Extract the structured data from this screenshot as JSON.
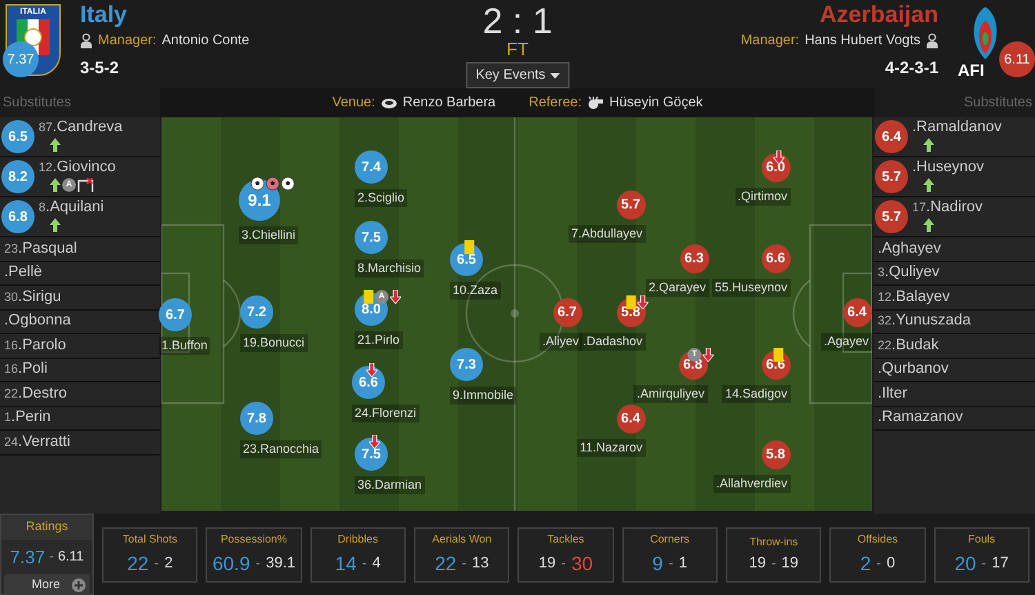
{
  "home": {
    "name": "Italy",
    "logo_text": "ITALIA",
    "rating": "7.37",
    "manager_label": "Manager:",
    "manager": "Antonio Conte",
    "formation": "3-5-2"
  },
  "away": {
    "name": "Azerbaijan",
    "logo_text": "AFI",
    "rating": "6.11",
    "manager_label": "Manager:",
    "manager": "Hans Hubert Vogts",
    "formation": "4-2-3-1"
  },
  "score": "2 : 1",
  "status": "FT",
  "key_events_button": "Key Events",
  "venue_bar": {
    "left_title": "Substitutes",
    "venue_label": "Venue:",
    "venue": "Renzo Barbera",
    "referee_label": "Referee:",
    "referee": "Hüseyin Göçek",
    "right_title": "Substitutes"
  },
  "home_subs": [
    {
      "number": "87",
      "name": ".Candreva",
      "rating": "6.5",
      "events": [
        {
          "kind": "sub_on"
        }
      ]
    },
    {
      "number": "12",
      "name": ".Giovinco",
      "rating": "8.2",
      "events": [
        {
          "kind": "sub_on"
        },
        {
          "kind": "letter",
          "label": "A"
        },
        {
          "kind": "goal_miss"
        }
      ]
    },
    {
      "number": "8",
      "name": ".Aquilani",
      "rating": "6.8",
      "events": [
        {
          "kind": "sub_on"
        }
      ]
    },
    {
      "number": "23",
      "name": ".Pasqual"
    },
    {
      "name": ".Pellè"
    },
    {
      "number": "30",
      "name": ".Sirigu"
    },
    {
      "name": ".Ogbonna"
    },
    {
      "number": "16",
      "name": ".Parolo"
    },
    {
      "number": "16",
      "name": ".Poli"
    },
    {
      "number": "22",
      "name": ".Destro"
    },
    {
      "number": "1",
      "name": ".Perin"
    },
    {
      "number": "24",
      "name": ".Verratti"
    }
  ],
  "away_subs": [
    {
      "name": ".Ramaldanov",
      "rating": "6.4",
      "events": [
        {
          "kind": "sub_on"
        }
      ]
    },
    {
      "name": ".Huseynov",
      "rating": "5.7",
      "events": [
        {
          "kind": "sub_on"
        }
      ]
    },
    {
      "number": "17",
      "name": ".Nadirov",
      "rating": "5.7",
      "events": [
        {
          "kind": "sub_on"
        }
      ]
    },
    {
      "name": ".Aghayev"
    },
    {
      "number": "3",
      "name": ".Quliyev"
    },
    {
      "number": "12",
      "name": ".Balayev"
    },
    {
      "number": "32",
      "name": ".Yunuszada"
    },
    {
      "number": "22",
      "name": ".Budak"
    },
    {
      "name": ".Qurbanov"
    },
    {
      "name": ".Ilter"
    },
    {
      "name": ".Ramazanov"
    }
  ],
  "home_players": [
    {
      "label": "1.Buffon",
      "rating": "6.7",
      "motm": false
    },
    {
      "label": "3.Chiellini",
      "rating": "9.1",
      "motm": true,
      "events": [
        {
          "kind": "goal"
        },
        {
          "kind": "own_goal"
        },
        {
          "kind": "goal"
        }
      ]
    },
    {
      "label": "19.Bonucci",
      "rating": "7.2",
      "motm": false
    },
    {
      "label": "23.Ranocchia",
      "rating": "7.8",
      "motm": false
    },
    {
      "label": "2.Sciglio",
      "rating": "7.4",
      "motm": false
    },
    {
      "label": "8.Marchisio",
      "rating": "7.5",
      "motm": false
    },
    {
      "label": "21.Pirlo",
      "rating": "8.0",
      "motm": false,
      "events": [
        {
          "kind": "yellow_card"
        },
        {
          "kind": "letter",
          "label": "A"
        },
        {
          "kind": "sub_off"
        }
      ]
    },
    {
      "label": "24.Florenzi",
      "rating": "6.6",
      "motm": false,
      "events": [
        {
          "kind": "sub_off"
        }
      ]
    },
    {
      "label": "36.Darmian",
      "rating": "7.5",
      "motm": false,
      "events": [
        {
          "kind": "sub_off"
        }
      ]
    },
    {
      "label": "10.Zaza",
      "rating": "6.5",
      "motm": false,
      "events": [
        {
          "kind": "yellow_card"
        }
      ]
    },
    {
      "label": "9.Immobile",
      "rating": "7.3",
      "motm": false
    }
  ],
  "away_players": [
    {
      "label": ".Aliyev",
      "rating": "6.7",
      "motm": false
    },
    {
      "label": "7.Abdullayev",
      "rating": "5.7",
      "motm": false
    },
    {
      "label": ".Dadashov",
      "rating": "5.8",
      "motm": false,
      "events": [
        {
          "kind": "yellow_card"
        },
        {
          "kind": "sub_off"
        }
      ]
    },
    {
      "label": "11.Nazarov",
      "rating": "6.4",
      "motm": false
    },
    {
      "label": "2.Qarayev",
      "rating": "6.3",
      "motm": false
    },
    {
      "label": ".Amirquliyev",
      "rating": "6.8",
      "motm": false,
      "events": [
        {
          "kind": "letter",
          "label": "T"
        },
        {
          "kind": "sub_off"
        }
      ]
    },
    {
      "label": ".Qirtimov",
      "rating": "6.0",
      "motm": false,
      "events": [
        {
          "kind": "sub_off"
        }
      ]
    },
    {
      "label": "55.Huseynov",
      "rating": "6.6",
      "motm": false
    },
    {
      "label": "14.Sadigov",
      "rating": "6.6",
      "motm": false,
      "events": [
        {
          "kind": "yellow_card"
        }
      ]
    },
    {
      "label": ".Allahverdiev",
      "rating": "5.8",
      "motm": false
    },
    {
      "label": ".Agayev",
      "rating": "6.4",
      "motm": false
    }
  ],
  "ratings": {
    "title": "Ratings",
    "home": "7.37",
    "separator": "-",
    "away": "6.11",
    "more_button": "More"
  },
  "stats": [
    {
      "title": "Total Shots",
      "home": "22",
      "separator": "-",
      "away": "2",
      "home_leads": true,
      "away_leads": false
    },
    {
      "title": "Possession%",
      "home": "60.9",
      "separator": "-",
      "away": "39.1",
      "home_leads": true,
      "away_leads": false
    },
    {
      "title": "Dribbles",
      "home": "14",
      "separator": "-",
      "away": "4",
      "home_leads": true,
      "away_leads": false
    },
    {
      "title": "Aerials Won",
      "home": "22",
      "separator": "-",
      "away": "13",
      "home_leads": true,
      "away_leads": false
    },
    {
      "title": "Tackles",
      "home": "19",
      "separator": "-",
      "away": "30",
      "home_leads": false,
      "away_leads": true
    },
    {
      "title": "Corners",
      "home": "9",
      "separator": "-",
      "away": "1",
      "home_leads": true,
      "away_leads": false
    },
    {
      "title": "Throw-ins",
      "home": "19",
      "separator": "-",
      "away": "19",
      "home_leads": false,
      "away_leads": false
    },
    {
      "title": "Offsides",
      "home": "2",
      "separator": "-",
      "away": "0",
      "home_leads": true,
      "away_leads": false
    },
    {
      "title": "Fouls",
      "home": "20",
      "separator": "-",
      "away": "17",
      "home_leads": true,
      "away_leads": false
    }
  ]
}
